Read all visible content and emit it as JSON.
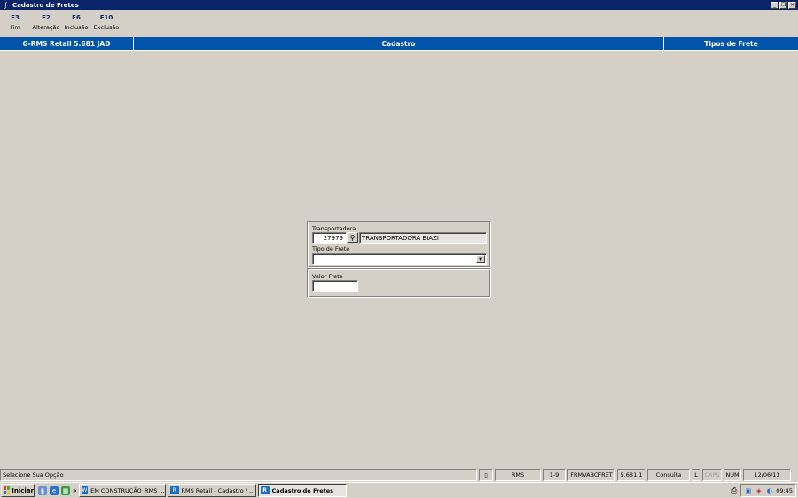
{
  "window": {
    "title": "Cadastro de Fretes"
  },
  "fkeys": [
    {
      "key": "F3",
      "label": "Fim"
    },
    {
      "key": "F2",
      "label": "Alteração"
    },
    {
      "key": "F6",
      "label": "Inclusão"
    },
    {
      "key": "F10",
      "label": "Exclusão"
    }
  ],
  "header": {
    "app": "G-RMS Retail 5.681 JAD",
    "section": "Cadastro",
    "subsection": "Tipos de Frete"
  },
  "form": {
    "transportadora_label": "Transportadora",
    "transportadora_code": "27979",
    "transportadora_name": "TRANSPORTADORA BIAZI",
    "tipo_frete_label": "Tipo de Frete",
    "tipo_frete_value": "",
    "valor_frete_label": "Valor Frete",
    "valor_frete_value": ""
  },
  "status": {
    "message": "Selecione Sua Opção",
    "system": "RMS",
    "range": "1-9",
    "form_id": "FRMVABCFRET",
    "version": "5.681.1",
    "mode": "Consulta",
    "l": "L",
    "caps": "CAPS",
    "num": "NUM",
    "date": "12/06/13"
  },
  "taskbar": {
    "start": "Iniciar",
    "chevron": "»",
    "tasks": [
      "EM CONSTRUÇÃO_RMS ...",
      "RMS Retail - Cadastro / ...",
      "Cadastro de Fretes"
    ],
    "clock": "09:45"
  }
}
